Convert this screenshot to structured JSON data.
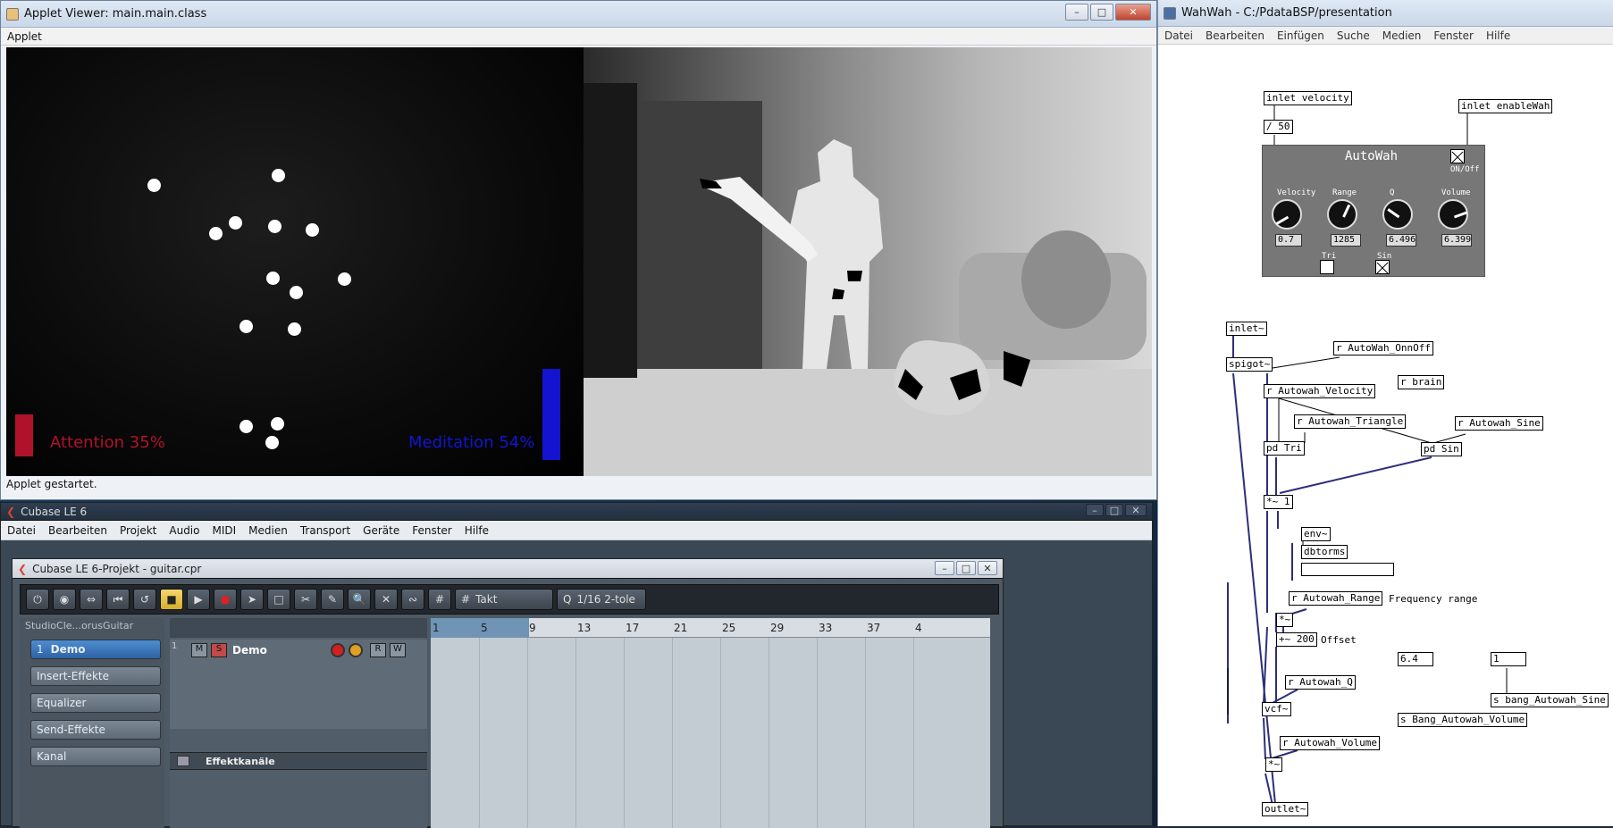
{
  "applet": {
    "title": "Applet Viewer: main.main.class",
    "menu": [
      "Applet"
    ],
    "attention_label": "Attention 35%",
    "meditation_label": "Meditation 54%",
    "attention_level": 0.35,
    "meditation_level": 0.54,
    "status": "Applet gestartet.",
    "colors": {
      "attention": "#b0122b",
      "meditation": "#1414d0"
    }
  },
  "cubase": {
    "title": "Cubase LE 6",
    "menu": [
      "Datei",
      "Bearbeiten",
      "Projekt",
      "Audio",
      "MIDI",
      "Medien",
      "Transport",
      "Geräte",
      "Fenster",
      "Hilfe"
    ],
    "project_title": "Cubase LE 6-Projekt - guitar.cpr",
    "toolbar": {
      "quantize_select": "Takt",
      "grid_select": "1/16  2-tole"
    },
    "inspector": {
      "preset": "StudioCle...orusGuitar",
      "track_name": "Demo",
      "track_number": "1",
      "sections": [
        "Insert-Effekte",
        "Equalizer",
        "Send-Effekte",
        "Kanal"
      ]
    },
    "tracks": [
      {
        "number": "1",
        "name": "Demo"
      }
    ],
    "folder": "Effektkanäle",
    "ruler": [
      "1",
      "5",
      "9",
      "13",
      "17",
      "21",
      "25",
      "29",
      "33",
      "37",
      "4"
    ]
  },
  "pd": {
    "title": "WahWah  -  C:/PdataBSP/presentation",
    "menu": [
      "Datei",
      "Bearbeiten",
      "Einfügen",
      "Suche",
      "Medien",
      "Fenster",
      "Hilfe"
    ],
    "autowah": {
      "title": "AutoWah",
      "onoff_label": "ON/Off",
      "knobs": [
        {
          "label": "Velocity",
          "value": "0.7"
        },
        {
          "label": "Range",
          "value": "1285"
        },
        {
          "label": "Q",
          "value": "6.496"
        },
        {
          "label": "Volume",
          "value": "6.399"
        }
      ],
      "tri_label": "Tri",
      "sin_label": "Sin"
    },
    "objects": {
      "inlet_velocity": "inlet velocity",
      "div50": "/ 50",
      "inlet_enable": "inlet enableWah",
      "inlet_sig": "inlet~",
      "r_onoff": "r AutoWah_OnnOff",
      "spigot": "spigot~",
      "r_velocity": "r Autowah_Velocity",
      "r_brain": "r brain",
      "r_triangle": "r Autowah_Triangle",
      "r_sine": "r Autowah_Sine",
      "pd_tri": "pd Tri",
      "pd_sin": "pd Sin",
      "mul1": "*~ 1",
      "env": "env~",
      "dbtorms": "dbtorms",
      "r_range": "r Autowah_Range",
      "freq_comment": "Frequency range",
      "mul2": "*~",
      "add200": "+~ 200",
      "offset_comment": "Offset",
      "r_q": "r Autowah_Q",
      "vcf": "vcf~",
      "r_volume": "r Autowah_Volume",
      "mul3": "*~",
      "outlet": "outlet~",
      "num64": "6.4",
      "num1": "1",
      "s_bang_sine": "s bang_Autowah_Sine",
      "s_bang_volume": "s Bang_Autowah_Volume"
    }
  }
}
